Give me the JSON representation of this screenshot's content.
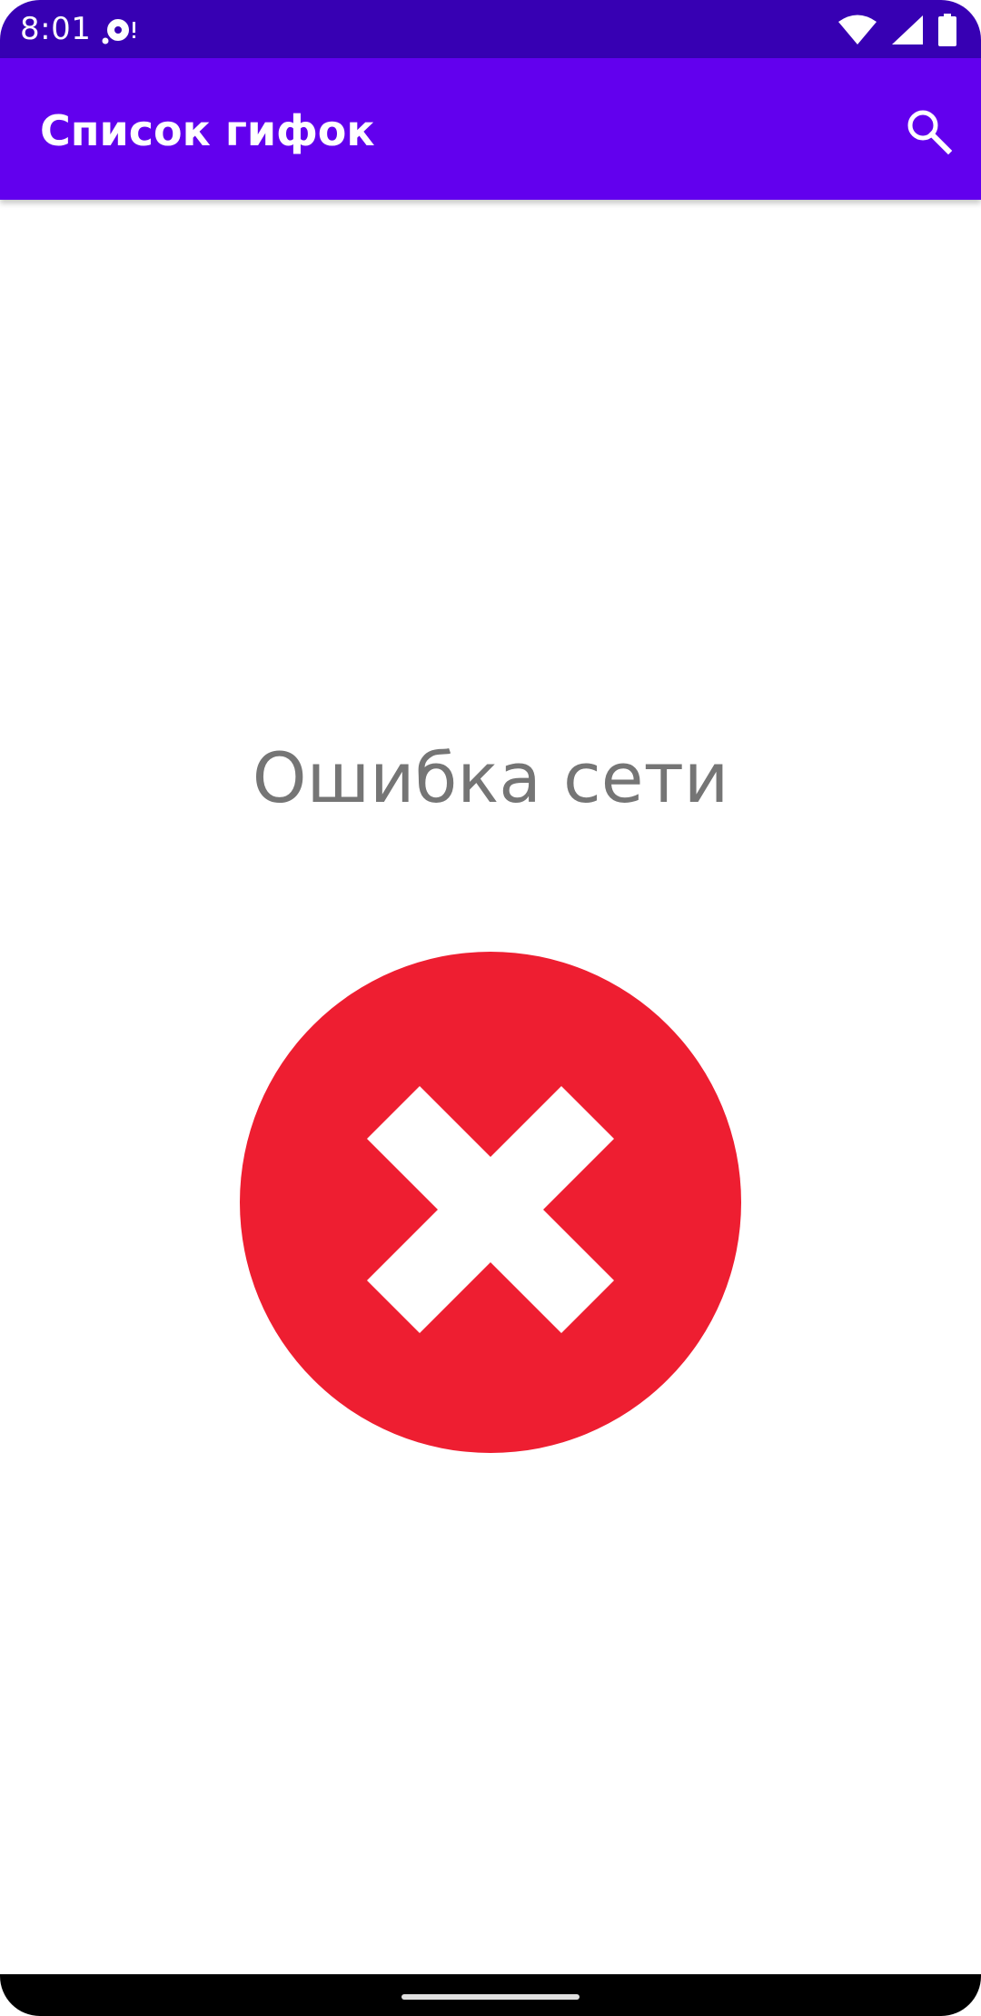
{
  "status_bar": {
    "time": "8:01",
    "notification_icon": "media-cast-icon",
    "wifi_icon": "wifi-icon",
    "signal_icon": "cell-signal-icon",
    "battery_icon": "battery-icon"
  },
  "app_bar": {
    "title": "Список гифок",
    "search_icon": "search-icon",
    "color": "#6200ee"
  },
  "content": {
    "error_message": "Ошибка сети",
    "error_icon": "error-cross-icon",
    "error_color": "#ee1e31"
  },
  "colors": {
    "status_bar": "#3700b3",
    "app_bar": "#6200ee",
    "text_gray": "#757575"
  }
}
